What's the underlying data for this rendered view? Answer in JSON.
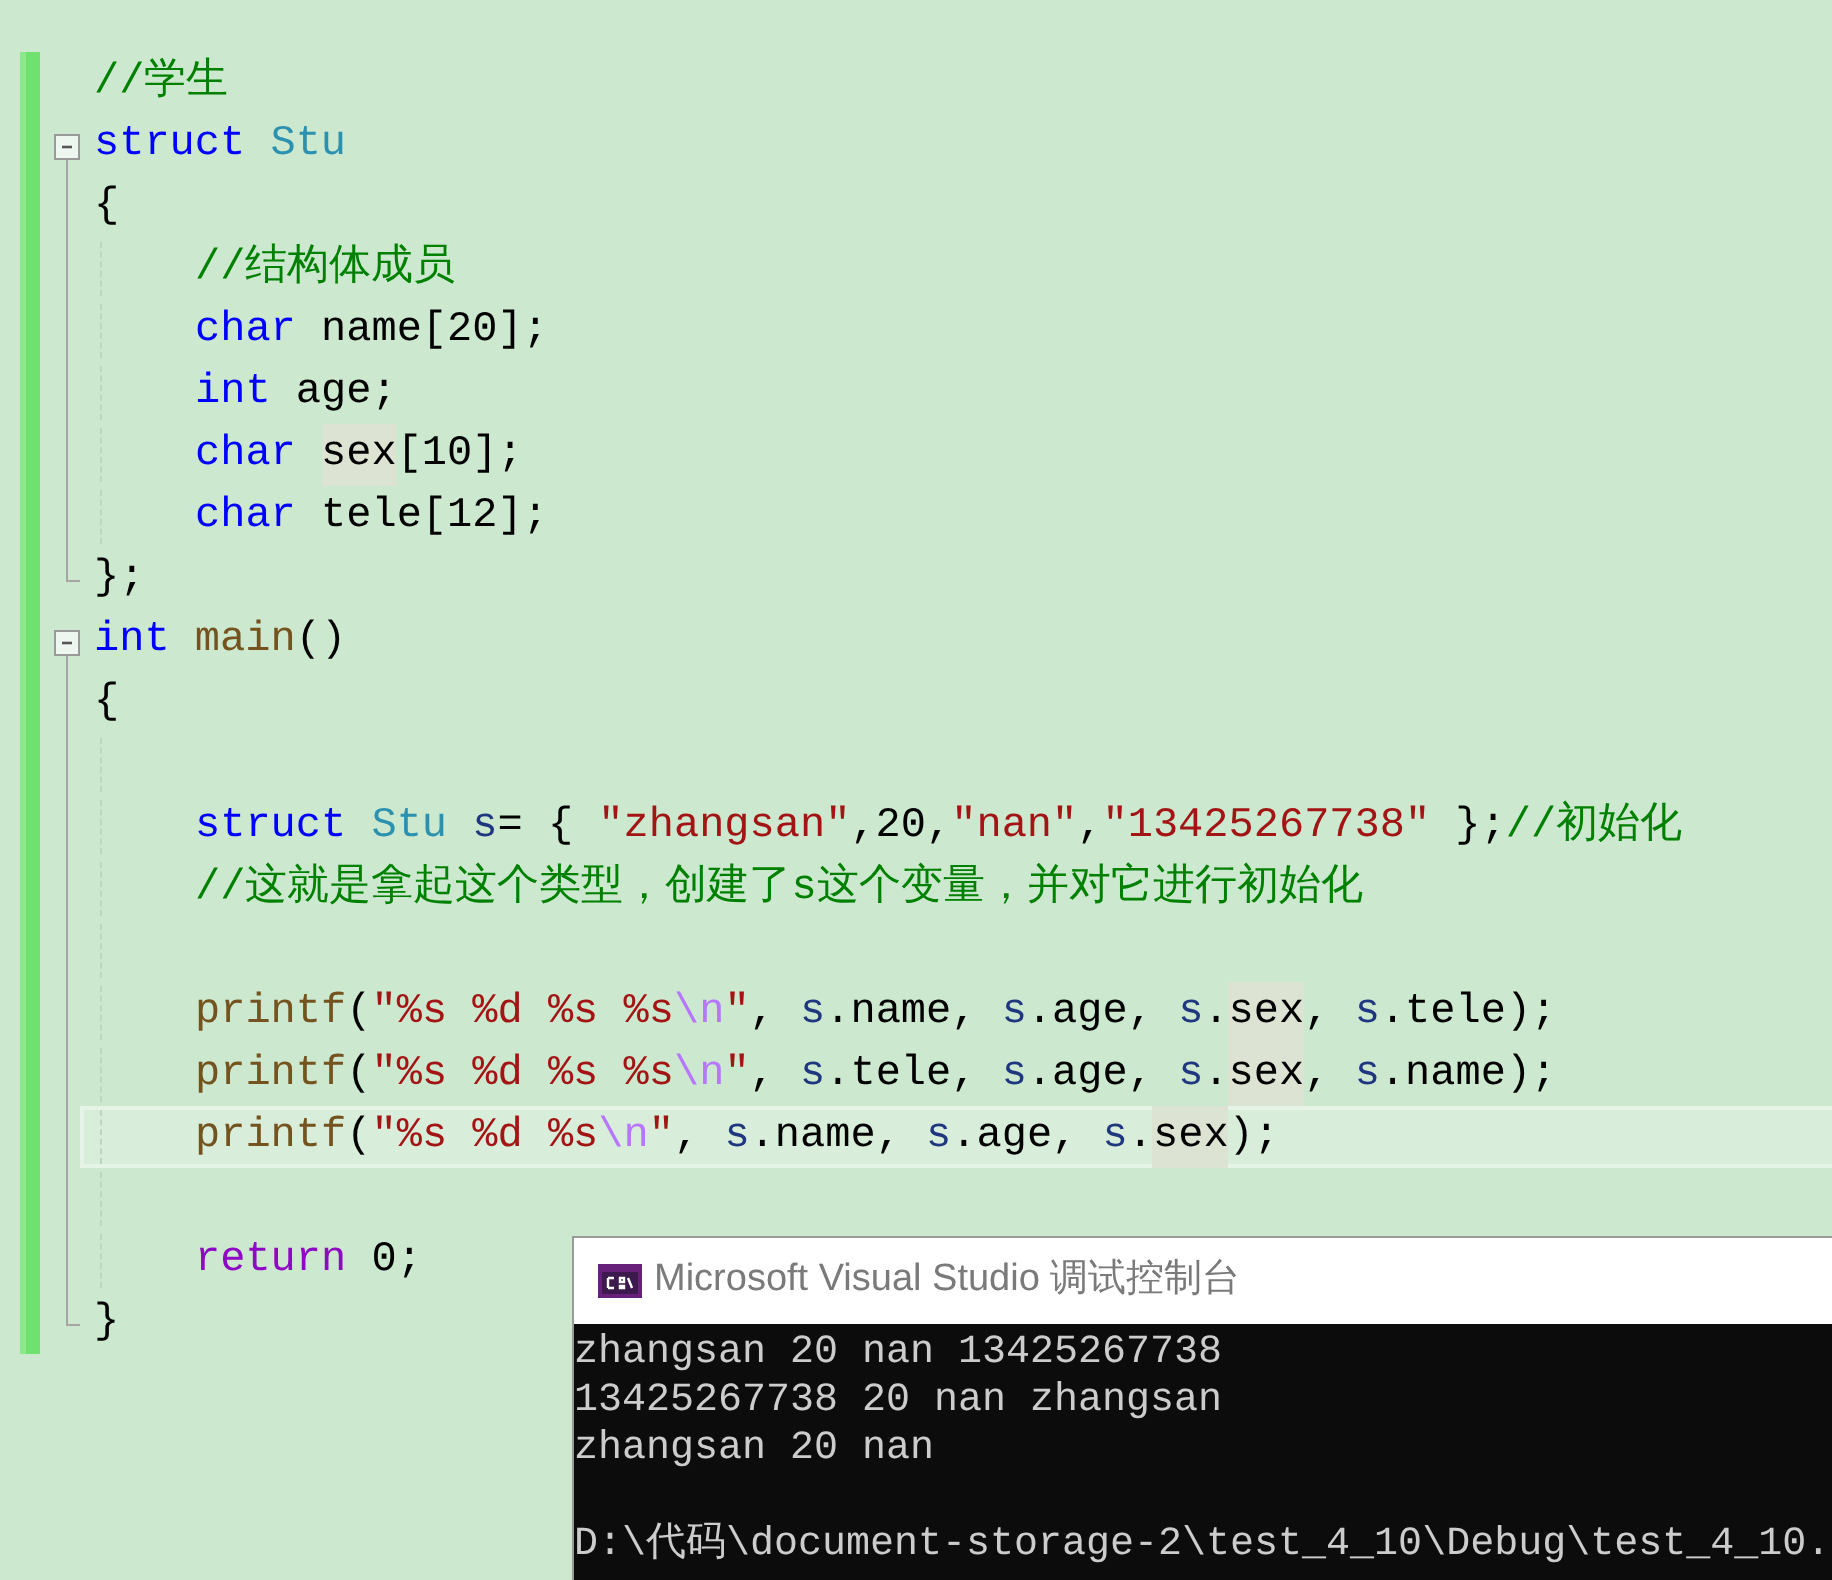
{
  "editor": {
    "lines": [
      {
        "kind": "code",
        "current": false,
        "tokens": [
          {
            "kind": "comment",
            "text": "//学生"
          }
        ]
      },
      {
        "kind": "code",
        "current": false,
        "expanded": true,
        "tokens": [
          {
            "kind": "keyword",
            "text": "struct "
          },
          {
            "kind": "type",
            "text": "Stu"
          }
        ]
      },
      {
        "kind": "code",
        "current": false,
        "tokens": [
          {
            "kind": "plain",
            "text": "{"
          }
        ],
        "children": [
          {
            "kind": "code",
            "current": false,
            "tokens": [
              {
                "kind": "comment",
                "text": "//结构体成员"
              }
            ]
          },
          {
            "kind": "code",
            "current": false,
            "tokens": [
              {
                "kind": "keyword",
                "text": "char"
              },
              {
                "kind": "plain",
                "text": " name[20];"
              }
            ]
          },
          {
            "kind": "code",
            "current": false,
            "tokens": [
              {
                "kind": "keyword",
                "text": "int"
              },
              {
                "kind": "plain",
                "text": " age;"
              }
            ]
          },
          {
            "kind": "code",
            "current": false,
            "tokens": [
              {
                "kind": "keyword",
                "text": "char "
              },
              {
                "kind": "plain",
                "text": "sex",
                "highlight": true
              },
              {
                "kind": "plain",
                "text": "[10];"
              }
            ]
          },
          {
            "kind": "code",
            "current": false,
            "tokens": [
              {
                "kind": "keyword",
                "text": "char"
              },
              {
                "kind": "plain",
                "text": " tele[12];"
              }
            ]
          }
        ]
      },
      {
        "kind": "code",
        "current": false,
        "tokens": [
          {
            "kind": "plain",
            "text": "};"
          }
        ]
      },
      {
        "kind": "code",
        "current": false,
        "expanded": true,
        "tokens": [
          {
            "kind": "keyword",
            "text": "int "
          },
          {
            "kind": "func",
            "text": "main"
          },
          {
            "kind": "plain",
            "text": "()"
          }
        ]
      },
      {
        "kind": "code",
        "current": false,
        "tokens": [
          {
            "kind": "plain",
            "text": "{"
          }
        ],
        "children": [
          {
            "kind": "blank",
            "current": false
          },
          {
            "kind": "code",
            "current": false,
            "tokens": [
              {
                "kind": "keyword",
                "text": "struct "
              },
              {
                "kind": "type",
                "text": "Stu "
              },
              {
                "kind": "var",
                "text": "s"
              },
              {
                "kind": "plain",
                "text": "= { "
              },
              {
                "kind": "string",
                "text": "\"zhangsan\""
              },
              {
                "kind": "plain",
                "text": ",20,"
              },
              {
                "kind": "string",
                "text": "\"nan\""
              },
              {
                "kind": "plain",
                "text": ","
              },
              {
                "kind": "string",
                "text": "\"13425267738\""
              },
              {
                "kind": "plain",
                "text": " };"
              },
              {
                "kind": "comment",
                "text": "//初始化"
              }
            ]
          },
          {
            "kind": "code",
            "current": false,
            "tokens": [
              {
                "kind": "comment",
                "text": "//这就是拿起这个类型，创建了s这个变量，并对它进行初始化"
              }
            ]
          },
          {
            "kind": "blank",
            "current": false
          },
          {
            "kind": "code",
            "current": false,
            "tokens": [
              {
                "kind": "func",
                "text": "printf"
              },
              {
                "kind": "plain",
                "text": "("
              },
              {
                "kind": "string",
                "text": "\"%s %d %s %s"
              },
              {
                "kind": "escape",
                "text": "\\n"
              },
              {
                "kind": "string",
                "text": "\""
              },
              {
                "kind": "plain",
                "text": ", "
              },
              {
                "kind": "var",
                "text": "s"
              },
              {
                "kind": "plain",
                "text": ".name, "
              },
              {
                "kind": "var",
                "text": "s"
              },
              {
                "kind": "plain",
                "text": ".age, "
              },
              {
                "kind": "var",
                "text": "s"
              },
              {
                "kind": "plain",
                "text": "."
              },
              {
                "kind": "plain",
                "text": "sex",
                "highlight": true
              },
              {
                "kind": "plain",
                "text": ", "
              },
              {
                "kind": "var",
                "text": "s"
              },
              {
                "kind": "plain",
                "text": ".tele);"
              }
            ]
          },
          {
            "kind": "code",
            "current": false,
            "tokens": [
              {
                "kind": "func",
                "text": "printf"
              },
              {
                "kind": "plain",
                "text": "("
              },
              {
                "kind": "string",
                "text": "\"%s %d %s %s"
              },
              {
                "kind": "escape",
                "text": "\\n"
              },
              {
                "kind": "string",
                "text": "\""
              },
              {
                "kind": "plain",
                "text": ", "
              },
              {
                "kind": "var",
                "text": "s"
              },
              {
                "kind": "plain",
                "text": ".tele, "
              },
              {
                "kind": "var",
                "text": "s"
              },
              {
                "kind": "plain",
                "text": ".age, "
              },
              {
                "kind": "var",
                "text": "s"
              },
              {
                "kind": "plain",
                "text": "."
              },
              {
                "kind": "plain",
                "text": "sex",
                "highlight": true
              },
              {
                "kind": "plain",
                "text": ", "
              },
              {
                "kind": "var",
                "text": "s"
              },
              {
                "kind": "plain",
                "text": ".name);"
              }
            ]
          },
          {
            "kind": "code",
            "current": true,
            "tokens": [
              {
                "kind": "func",
                "text": "printf"
              },
              {
                "kind": "plain",
                "text": "("
              },
              {
                "kind": "string",
                "text": "\"%s %d %s"
              },
              {
                "kind": "escape",
                "text": "\\n"
              },
              {
                "kind": "string",
                "text": "\""
              },
              {
                "kind": "plain",
                "text": ", "
              },
              {
                "kind": "var",
                "text": "s"
              },
              {
                "kind": "plain",
                "text": ".name, "
              },
              {
                "kind": "var",
                "text": "s"
              },
              {
                "kind": "plain",
                "text": ".age, "
              },
              {
                "kind": "var",
                "text": "s"
              },
              {
                "kind": "plain",
                "text": "."
              },
              {
                "kind": "plain",
                "text": "sex",
                "highlight": true
              },
              {
                "kind": "plain",
                "text": ");"
              }
            ]
          },
          {
            "kind": "blank",
            "current": false
          },
          {
            "kind": "code",
            "current": false,
            "tokens": [
              {
                "kind": "control",
                "text": "return"
              },
              {
                "kind": "plain",
                "text": " 0;"
              }
            ]
          }
        ]
      },
      {
        "kind": "code",
        "current": false,
        "tokens": [
          {
            "kind": "plain",
            "text": "}"
          }
        ]
      }
    ]
  },
  "console": {
    "title": "Microsoft Visual Studio 调试控制台",
    "lines": [
      {
        "kind": "text",
        "text": "zhangsan 20 nan 13425267738"
      },
      {
        "kind": "text",
        "text": "13425267738 20 nan zhangsan"
      },
      {
        "kind": "text",
        "text": "zhangsan 20 nan"
      },
      {
        "kind": "blank"
      },
      {
        "kind": "text",
        "text": "D:\\代码\\document-storage-2\\test_4_10\\Debug\\test_4_10."
      }
    ]
  }
}
